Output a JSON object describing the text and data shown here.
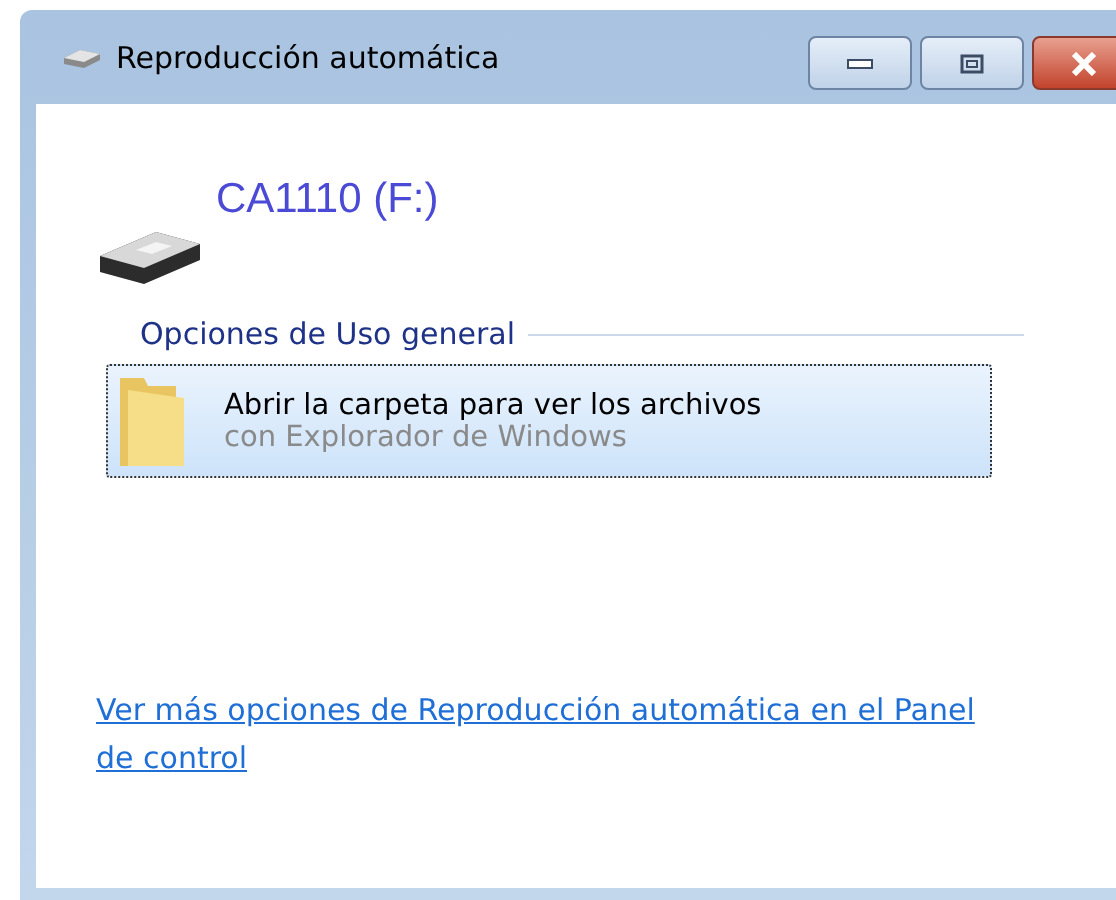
{
  "window": {
    "title": "Reproducción automática"
  },
  "device": {
    "name": "CA1110 (F:)"
  },
  "section": {
    "title": "Opciones de Uso general"
  },
  "options": [
    {
      "title": "Abrir la carpeta para ver los archivos",
      "subtitle": "con Explorador de Windows",
      "selected": true
    }
  ],
  "link": {
    "text": "Ver más opciones de Reproducción automática en el Panel de control"
  }
}
